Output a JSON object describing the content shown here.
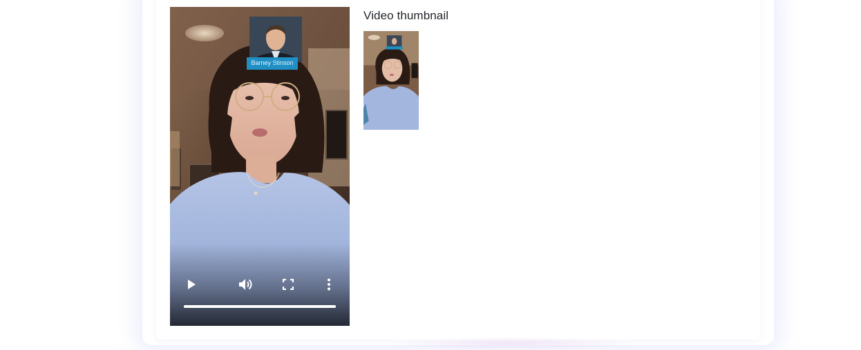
{
  "video": {
    "overlay_tag": "Barney Stinson",
    "progress_fraction": 1.0,
    "controls": {
      "play_icon": "play-icon",
      "volume_icon": "volume-icon",
      "fullscreen_icon": "fullscreen-icon",
      "more_icon": "more-vertical-icon"
    }
  },
  "thumbnail": {
    "heading": "Video thumbnail"
  },
  "colors": {
    "tag_blue": "#1f8fc4",
    "heading_text": "#1f2328",
    "dress_blue": "#a3b6de",
    "hair": "#2a1a14"
  }
}
